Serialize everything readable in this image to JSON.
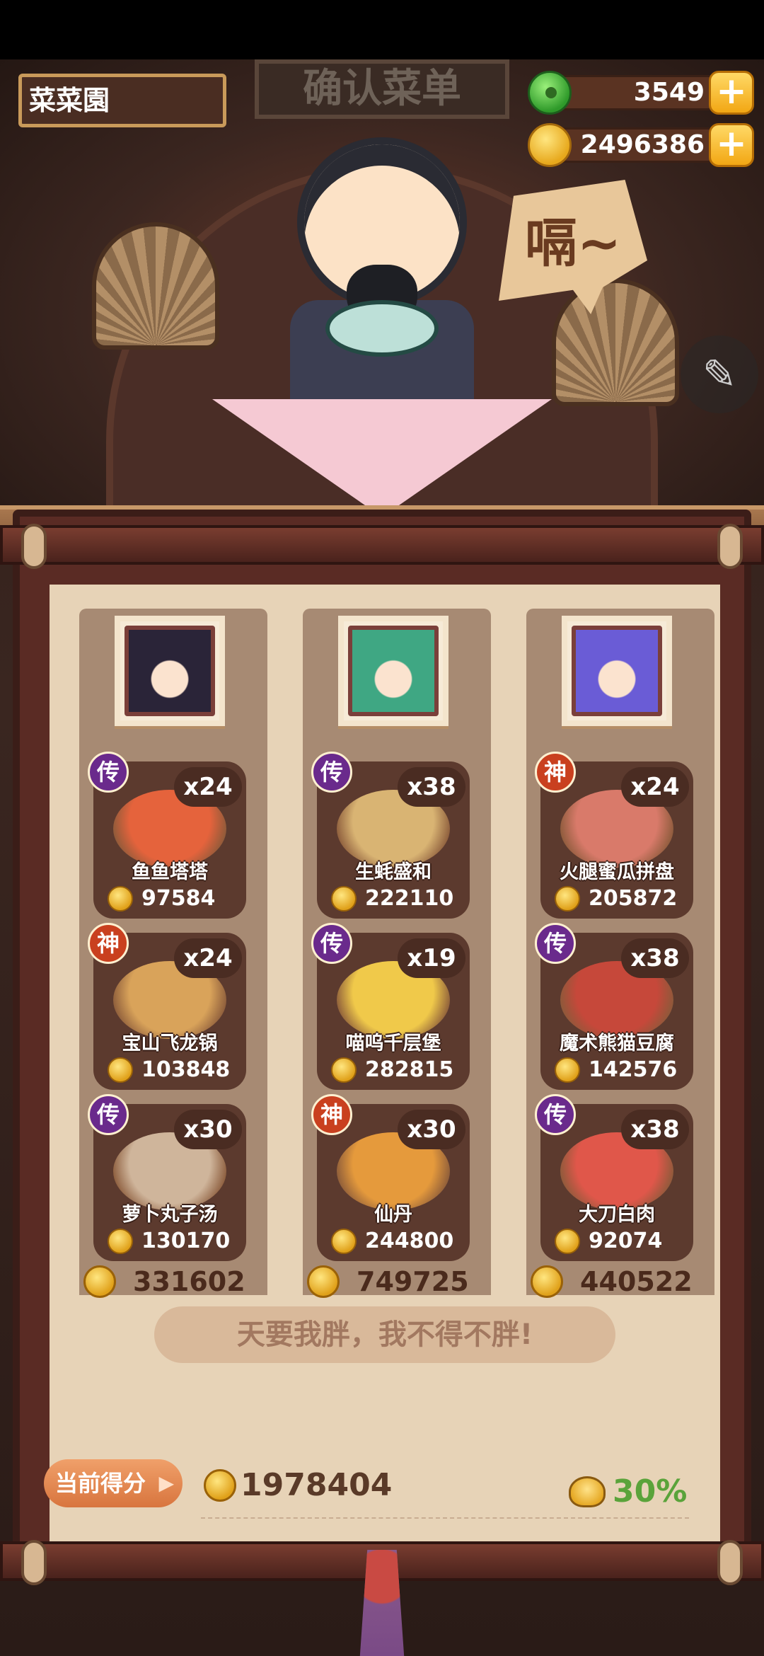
{
  "header": {
    "restaurant_name": "菜菜園",
    "sign_title": "确认菜单",
    "speech_text": "嗝~",
    "currencies": [
      {
        "icon": "jade-icon",
        "value": "3549"
      },
      {
        "icon": "coin-icon",
        "value": "2496386"
      }
    ]
  },
  "columns": [
    {
      "avatar": "chef-avatar-1",
      "dishes": [
        {
          "grade": "传",
          "name": "鱼鱼塔塔",
          "count": "x24",
          "price": "97584",
          "food_color": "#e5633c"
        },
        {
          "grade": "神",
          "name": "宝山飞龙锅",
          "count": "x24",
          "price": "103848",
          "food_color": "#d9a35a"
        },
        {
          "grade": "传",
          "name": "萝卜丸子汤",
          "count": "x30",
          "price": "130170",
          "food_color": "#cfb59b"
        }
      ],
      "total": "331602"
    },
    {
      "avatar": "chef-avatar-2",
      "dishes": [
        {
          "grade": "传",
          "name": "生蚝盛和",
          "count": "x38",
          "price": "222110",
          "food_color": "#d9b473"
        },
        {
          "grade": "传",
          "name": "喵呜千层堡",
          "count": "x19",
          "price": "282815",
          "food_color": "#f0c94a"
        },
        {
          "grade": "神",
          "name": "仙丹",
          "count": "x30",
          "price": "244800",
          "food_color": "#e59a3c"
        }
      ],
      "total": "749725"
    },
    {
      "avatar": "chef-avatar-3",
      "dishes": [
        {
          "grade": "神",
          "name": "火腿蜜瓜拼盘",
          "count": "x24",
          "price": "205872",
          "food_color": "#d97a6a"
        },
        {
          "grade": "传",
          "name": "魔术熊猫豆腐",
          "count": "x38",
          "price": "142576",
          "food_color": "#c6483a"
        },
        {
          "grade": "传",
          "name": "大刀白肉",
          "count": "x38",
          "price": "92074",
          "food_color": "#e0574a"
        }
      ],
      "total": "440522"
    }
  ],
  "quote": "天要我胖，我不得不胖!",
  "footer": {
    "score_label": "当前得分",
    "score_value": "1978404",
    "bonus_value": "30%"
  }
}
